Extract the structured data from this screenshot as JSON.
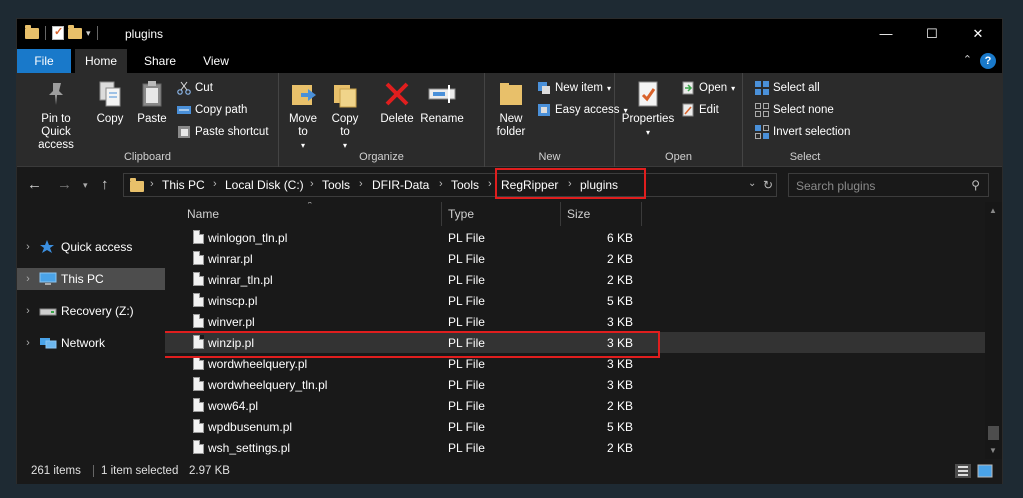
{
  "window": {
    "title": "plugins",
    "controls": {
      "minimize": "—",
      "maximize": "☐",
      "close": "✕"
    }
  },
  "ribbon_tabs": [
    "File",
    "Home",
    "Share",
    "View"
  ],
  "ribbon": {
    "clipboard": {
      "pin": "Pin to Quick access",
      "copy": "Copy",
      "paste": "Paste",
      "cut": "Cut",
      "copy_path": "Copy path",
      "paste_shortcut": "Paste shortcut",
      "label": "Clipboard"
    },
    "organize": {
      "move_to": "Move to",
      "copy_to": "Copy to",
      "delete": "Delete",
      "rename": "Rename",
      "label": "Organize"
    },
    "new": {
      "new_folder": "New folder",
      "new_item": "New item",
      "easy_access": "Easy access",
      "label": "New"
    },
    "open": {
      "properties": "Properties",
      "open": "Open",
      "edit": "Edit",
      "label": "Open"
    },
    "select": {
      "select_all": "Select all",
      "select_none": "Select none",
      "invert": "Invert selection",
      "label": "Select"
    }
  },
  "breadcrumb": [
    "This PC",
    "Local Disk (C:)",
    "Tools",
    "DFIR-Data",
    "Tools",
    "RegRipper",
    "plugins"
  ],
  "search": {
    "placeholder": "Search plugins"
  },
  "nav_pane": [
    {
      "label": "Quick access",
      "icon": "star-icon"
    },
    {
      "label": "This PC",
      "icon": "computer-icon",
      "selected": true
    },
    {
      "label": "Recovery (Z:)",
      "icon": "drive-icon"
    },
    {
      "label": "Network",
      "icon": "network-icon"
    }
  ],
  "columns": {
    "name": "Name",
    "type": "Type",
    "size": "Size"
  },
  "files": [
    {
      "name": "winlogon_tln.pl",
      "type": "PL File",
      "size": "6 KB"
    },
    {
      "name": "winrar.pl",
      "type": "PL File",
      "size": "2 KB"
    },
    {
      "name": "winrar_tln.pl",
      "type": "PL File",
      "size": "2 KB"
    },
    {
      "name": "winscp.pl",
      "type": "PL File",
      "size": "5 KB"
    },
    {
      "name": "winver.pl",
      "type": "PL File",
      "size": "3 KB"
    },
    {
      "name": "winzip.pl",
      "type": "PL File",
      "size": "3 KB",
      "selected": true
    },
    {
      "name": "wordwheelquery.pl",
      "type": "PL File",
      "size": "3 KB"
    },
    {
      "name": "wordwheelquery_tln.pl",
      "type": "PL File",
      "size": "3 KB"
    },
    {
      "name": "wow64.pl",
      "type": "PL File",
      "size": "2 KB"
    },
    {
      "name": "wpdbusenum.pl",
      "type": "PL File",
      "size": "5 KB"
    },
    {
      "name": "wsh_settings.pl",
      "type": "PL File",
      "size": "2 KB"
    }
  ],
  "status": {
    "items": "261 items",
    "selected": "1 item selected",
    "size": "2.97 KB"
  },
  "colors": {
    "accent": "#1979ca",
    "highlight": "#e01e1e",
    "folder": "#e8c06a"
  }
}
